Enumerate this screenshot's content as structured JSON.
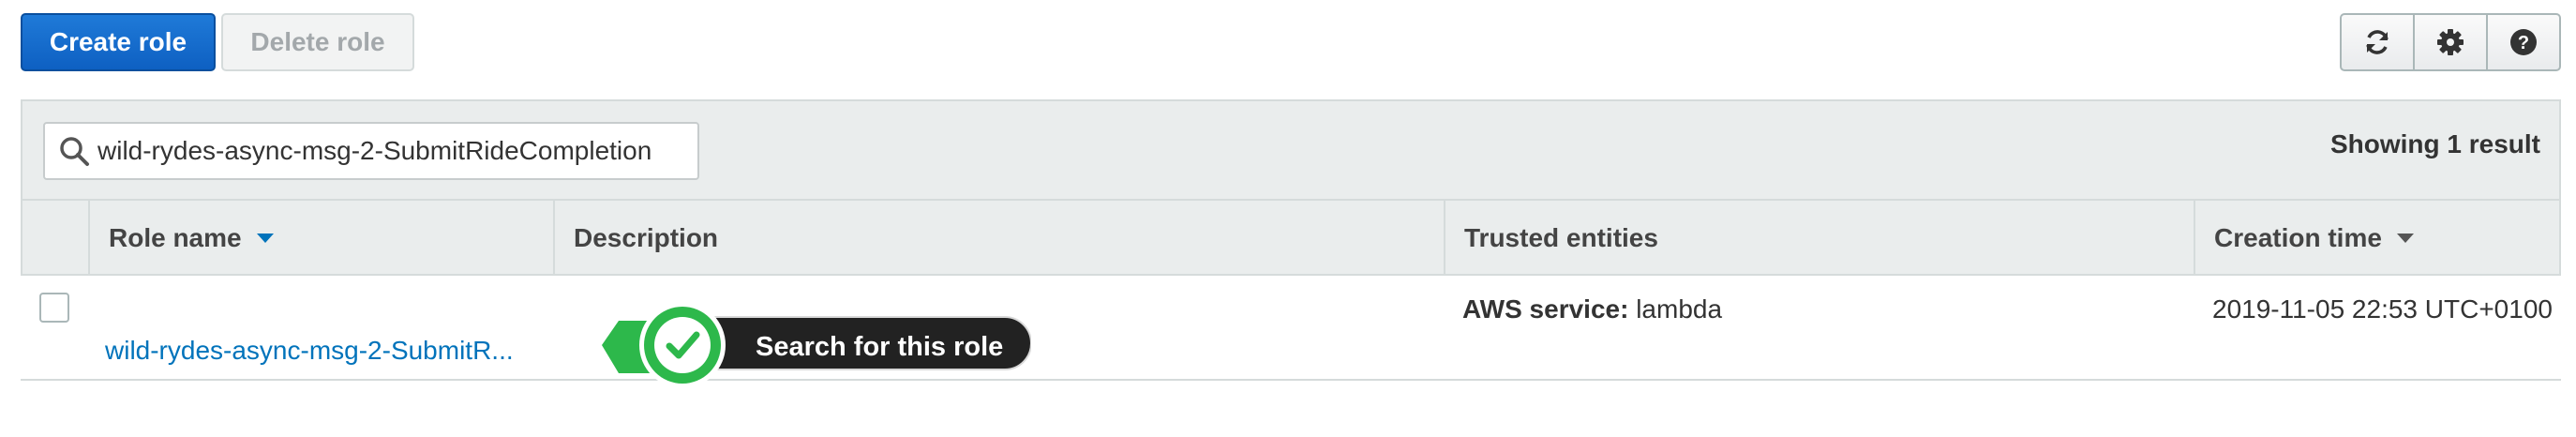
{
  "toolbar": {
    "create_label": "Create role",
    "delete_label": "Delete role",
    "icons": [
      "refresh-icon",
      "gear-icon",
      "help-icon"
    ]
  },
  "search": {
    "value": "wild-rydes-async-msg-2-SubmitRideCompletion",
    "result_text": "Showing 1 result"
  },
  "table": {
    "columns": [
      "Role name",
      "Description",
      "Trusted entities",
      "Creation time"
    ],
    "rows": [
      {
        "role_name": "wild-rydes-async-msg-2-SubmitR...",
        "description": "",
        "trusted_label": "AWS service:",
        "trusted_value": "lambda",
        "creation_time": "2019-11-05 22:53 UTC+0100"
      }
    ]
  },
  "callout": {
    "text": "Search for this role"
  },
  "colors": {
    "primary": "#0e60c2",
    "link": "#0073bb",
    "callout_green": "#2db84b",
    "callout_dark": "#222222"
  }
}
